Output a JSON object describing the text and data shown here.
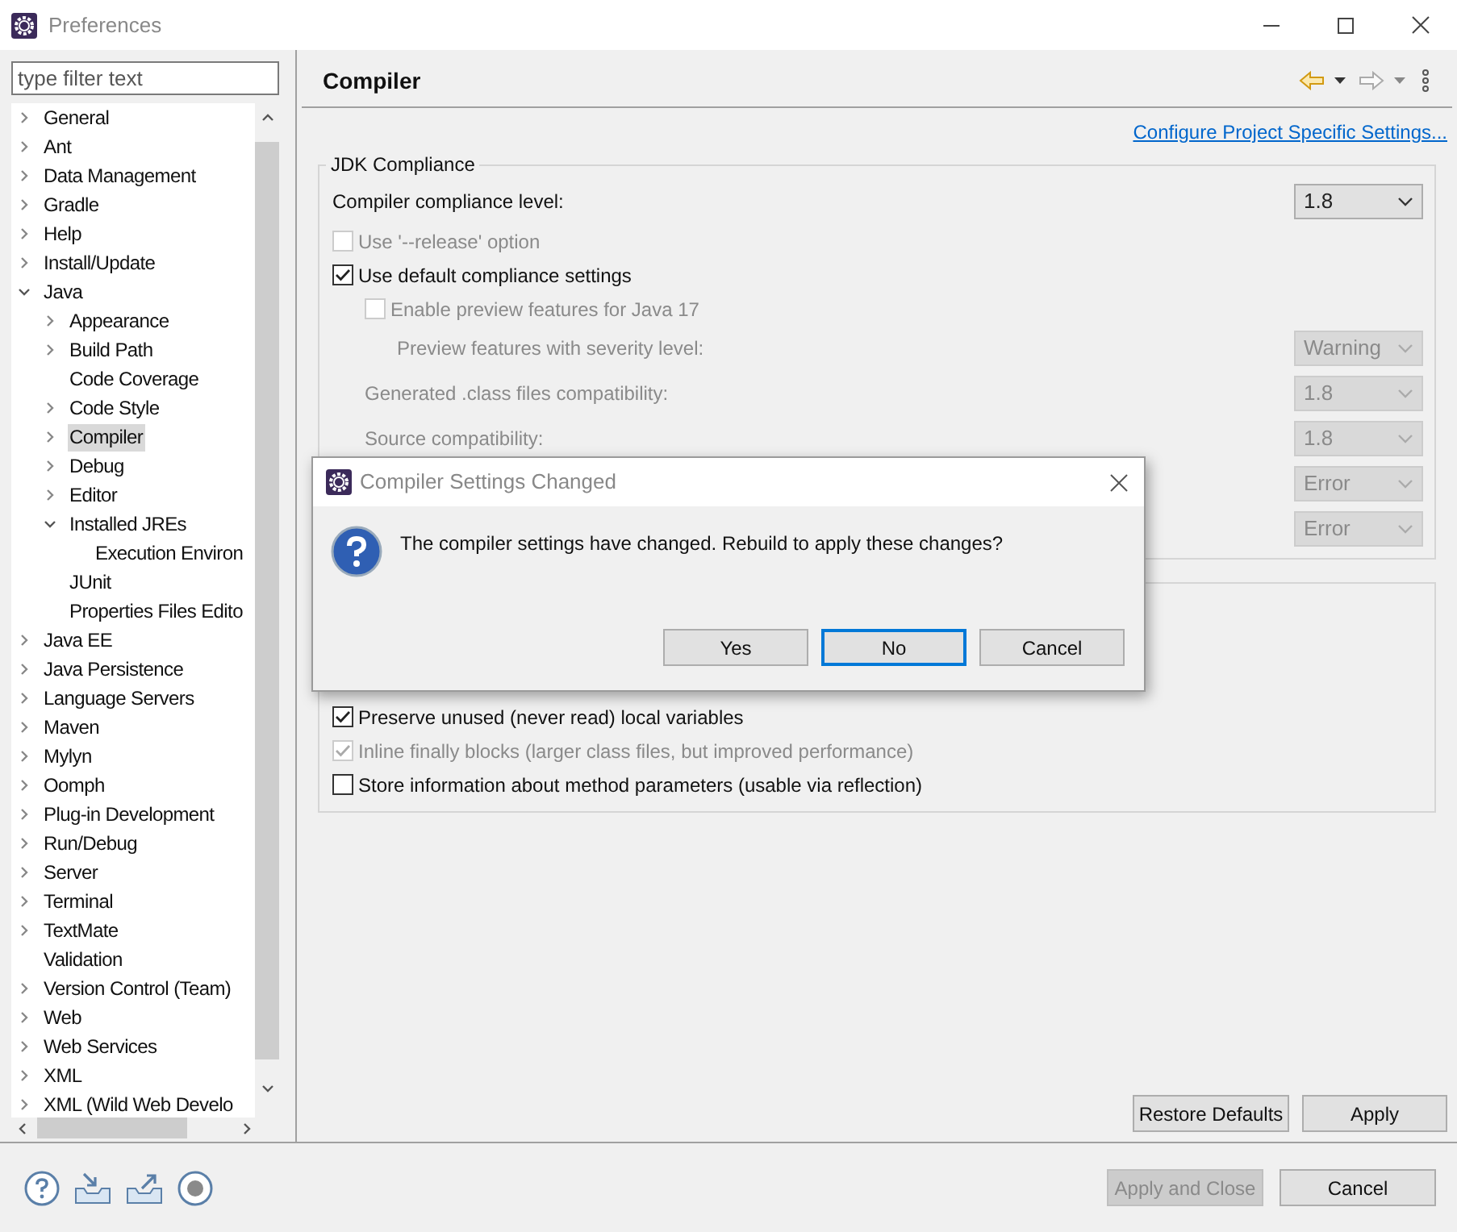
{
  "window": {
    "title": "Preferences"
  },
  "filter": {
    "placeholder": "type filter text"
  },
  "tree": [
    {
      "label": "General",
      "expanded": false,
      "selected": false
    },
    {
      "label": "Ant",
      "expanded": false,
      "selected": false
    },
    {
      "label": "Data Management",
      "expanded": false,
      "selected": false
    },
    {
      "label": "Gradle",
      "expanded": false,
      "selected": false
    },
    {
      "label": "Help",
      "expanded": false,
      "selected": false
    },
    {
      "label": "Install/Update",
      "expanded": false,
      "selected": false
    },
    {
      "label": "Java",
      "expanded": true,
      "selected": false,
      "children": [
        {
          "label": "Appearance",
          "expanded": false,
          "selected": false
        },
        {
          "label": "Build Path",
          "expanded": false,
          "selected": false
        },
        {
          "label": "Code Coverage",
          "selected": false
        },
        {
          "label": "Code Style",
          "expanded": false,
          "selected": false
        },
        {
          "label": "Compiler",
          "expanded": false,
          "selected": true
        },
        {
          "label": "Debug",
          "expanded": false,
          "selected": false
        },
        {
          "label": "Editor",
          "expanded": false,
          "selected": false
        },
        {
          "label": "Installed JREs",
          "expanded": true,
          "selected": false,
          "children": [
            {
              "label": "Execution Environ",
              "selected": false
            }
          ]
        },
        {
          "label": "JUnit",
          "selected": false
        },
        {
          "label": "Properties Files Edito",
          "selected": false
        }
      ]
    },
    {
      "label": "Java EE",
      "expanded": false,
      "selected": false
    },
    {
      "label": "Java Persistence",
      "expanded": false,
      "selected": false
    },
    {
      "label": "Language Servers",
      "expanded": false,
      "selected": false
    },
    {
      "label": "Maven",
      "expanded": false,
      "selected": false
    },
    {
      "label": "Mylyn",
      "expanded": false,
      "selected": false
    },
    {
      "label": "Oomph",
      "expanded": false,
      "selected": false
    },
    {
      "label": "Plug-in Development",
      "expanded": false,
      "selected": false
    },
    {
      "label": "Run/Debug",
      "expanded": false,
      "selected": false
    },
    {
      "label": "Server",
      "expanded": false,
      "selected": false
    },
    {
      "label": "Terminal",
      "expanded": false,
      "selected": false
    },
    {
      "label": "TextMate",
      "expanded": false,
      "selected": false
    },
    {
      "label": "Validation",
      "selected": false
    },
    {
      "label": "Version Control (Team)",
      "expanded": false,
      "selected": false
    },
    {
      "label": "Web",
      "expanded": false,
      "selected": false
    },
    {
      "label": "Web Services",
      "expanded": false,
      "selected": false
    },
    {
      "label": "XML",
      "expanded": false,
      "selected": false
    },
    {
      "label": "XML (Wild Web Develo",
      "expanded": false,
      "selected": false
    }
  ],
  "page": {
    "title": "Compiler",
    "link": "Configure Project Specific Settings..."
  },
  "jdk_compliance": {
    "title": "JDK Compliance",
    "rows": [
      {
        "kind": "combo",
        "label": "Compiler compliance level:",
        "value": "1.8",
        "disabled": false
      },
      {
        "kind": "checkbox",
        "label": "Use '--release' option",
        "checked": false,
        "disabled": true
      },
      {
        "kind": "checkbox",
        "label": "Use default compliance settings",
        "checked": true,
        "disabled": false,
        "children": [
          {
            "kind": "checkbox",
            "label": "Enable preview features for Java 17",
            "checked": false,
            "disabled": true,
            "children": [
              {
                "kind": "combo",
                "label": "Preview features with severity level:",
                "value": "Warning",
                "disabled": true
              }
            ]
          },
          {
            "kind": "combo",
            "label": "Generated .class files compatibility:",
            "value": "1.8",
            "disabled": true
          },
          {
            "kind": "combo",
            "label": "Source compatibility:",
            "value": "1.8",
            "disabled": true
          },
          {
            "kind": "combo",
            "value": "Error",
            "disabled": true
          },
          {
            "kind": "combo",
            "value": "Error",
            "disabled": true
          }
        ]
      }
    ]
  },
  "classfile_generation": {
    "rows": [
      {
        "kind": "checkbox",
        "label": "Preserve unused (never read) local variables",
        "checked": true,
        "disabled": false
      },
      {
        "kind": "checkbox",
        "label": "Inline finally blocks (larger class files, but improved performance)",
        "checked": true,
        "disabled": true
      },
      {
        "kind": "checkbox",
        "label": "Store information about method parameters (usable via reflection)",
        "checked": false,
        "disabled": false
      }
    ]
  },
  "page_buttons": [
    {
      "label": "Restore Defaults",
      "disabled": false
    },
    {
      "label": "Apply",
      "disabled": false
    }
  ],
  "footer_buttons": [
    {
      "label": "Apply and Close",
      "disabled": true
    },
    {
      "label": "Cancel",
      "disabled": false
    }
  ],
  "dialog": {
    "title": "Compiler Settings Changed",
    "message": "The compiler settings have changed. Rebuild to apply these changes?",
    "buttons": [
      {
        "label": "Yes",
        "selected": false
      },
      {
        "label": "No",
        "selected": true
      },
      {
        "label": "Cancel",
        "selected": false
      }
    ]
  }
}
